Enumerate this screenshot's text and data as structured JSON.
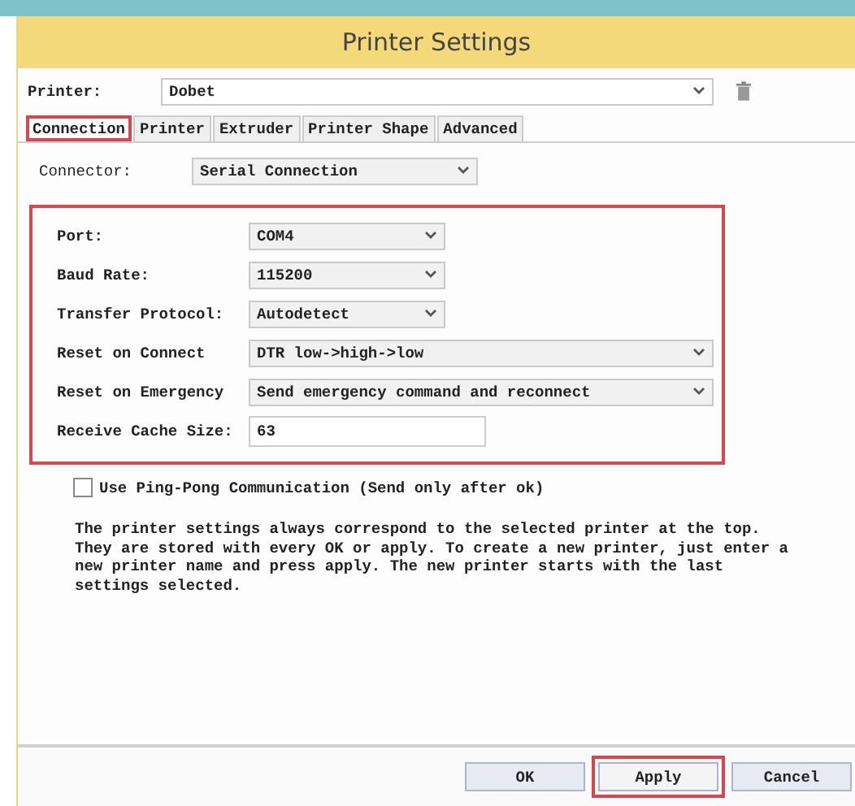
{
  "window": {
    "title": "Printer Settings"
  },
  "printer": {
    "label": "Printer:",
    "value": "Dobet"
  },
  "tabs": [
    {
      "label": "Connection",
      "selected": true,
      "highlighted": true
    },
    {
      "label": "Printer",
      "selected": false,
      "highlighted": false
    },
    {
      "label": "Extruder",
      "selected": false,
      "highlighted": false
    },
    {
      "label": "Printer Shape",
      "selected": false,
      "highlighted": false
    },
    {
      "label": "Advanced",
      "selected": false,
      "highlighted": false
    }
  ],
  "connector": {
    "label": "Connector:",
    "value": "Serial Connection"
  },
  "settings_group": {
    "highlighted": true,
    "fields": [
      {
        "label": "Port:",
        "kind": "select",
        "wide": false,
        "value": "COM4"
      },
      {
        "label": "Baud Rate:",
        "kind": "select",
        "wide": false,
        "value": "115200"
      },
      {
        "label": "Transfer Protocol:",
        "kind": "select",
        "wide": false,
        "value": "Autodetect"
      },
      {
        "label": "Reset on Connect",
        "kind": "select",
        "wide": true,
        "value": "DTR low->high->low"
      },
      {
        "label": "Reset on Emergency",
        "kind": "select",
        "wide": true,
        "value": "Send emergency command and reconnect"
      },
      {
        "label": "Receive Cache Size:",
        "kind": "text",
        "wide": false,
        "value": "63"
      }
    ]
  },
  "ping_pong": {
    "label": "Use Ping-Pong Communication (Send only after ok)",
    "checked": false
  },
  "info": "The printer settings always correspond to the selected printer at the top. They are stored with every OK or apply. To create a new printer, just enter a new printer name and press apply. The new printer starts with the last settings selected.",
  "buttons": [
    {
      "label": "OK",
      "highlighted": false
    },
    {
      "label": "Apply",
      "highlighted": true
    },
    {
      "label": "Cancel",
      "highlighted": false
    }
  ]
}
